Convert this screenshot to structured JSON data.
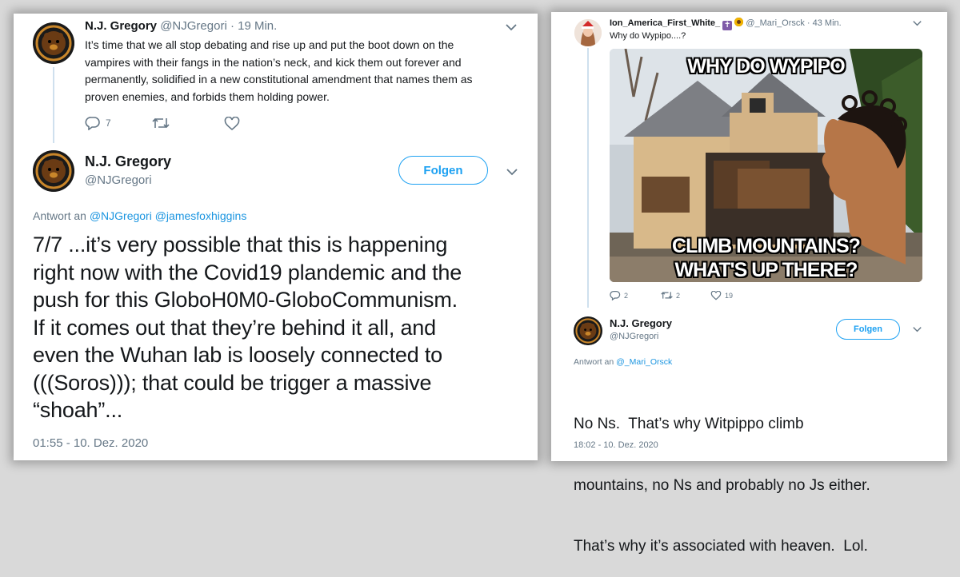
{
  "left": {
    "parent_tweet": {
      "name": "N.J. Gregory",
      "handle": "@NJGregori",
      "time": "· 19 Min.",
      "lines": [
        "It’s time that we all stop debating and rise up and put the boot down on the",
        "vampires with their fangs in the nation’s neck, and kick them out forever and",
        "permanently, solidified in a new constitutional amendment that names them as",
        "proven enemies, and forbids them holding power."
      ],
      "reply_count": "7"
    },
    "main_tweet": {
      "name": "N.J. Gregory",
      "handle": "@NJGregori",
      "follow_label": "Folgen",
      "reply_to_prefix": "Antwort an",
      "reply_to_handles": "@NJGregori @jamesfoxhiggins",
      "lines": [
        "7/7 ...it’s very possible that this is happening",
        "right now with the Covid19 plandemic and the",
        "push for this GloboH0M0-GloboCommunism.",
        "If it comes out that they’re behind it all, and",
        "even the Wuhan lab is loosely connected to",
        "(((Soros))); that could be trigger a massive",
        "“shoah”..."
      ],
      "timestamp": "01:55 - 10. Dez. 2020"
    }
  },
  "right": {
    "parent_tweet": {
      "name": "Ion_America_First_White_",
      "handle": "@_Mari_Orsck",
      "time": "· 43 Min.",
      "text": "Why do Wypipo....?",
      "meme_top": "WHY DO WYPIPO",
      "meme_bottom_1": "CLIMB MOUNTAINS?",
      "meme_bottom_2": "WHAT'S UP THERE?",
      "reply_count": "2",
      "retweet_count": "2",
      "like_count": "19"
    },
    "main_tweet": {
      "name": "N.J. Gregory",
      "handle": "@NJGregori",
      "follow_label": "Folgen",
      "reply_to_prefix": "Antwort an",
      "reply_to_handle": "@_Mari_Orsck",
      "lines": [
        "No Ns.  That’s why Witpippo climb",
        "mountains, no Ns and probably no Js either.",
        "That’s why it’s associated with heaven.  Lol."
      ],
      "timestamp": "18:02 - 10. Dez. 2020"
    }
  },
  "colors": {
    "link": "#1b95e0",
    "follow": "#1da1f2",
    "muted": "#657786"
  },
  "icons": [
    "chevron-down-icon",
    "reply-icon",
    "retweet-icon",
    "like-icon",
    "bear-logo-avatar",
    "cross-emoji-icon",
    "sunflower-emoji-icon"
  ]
}
